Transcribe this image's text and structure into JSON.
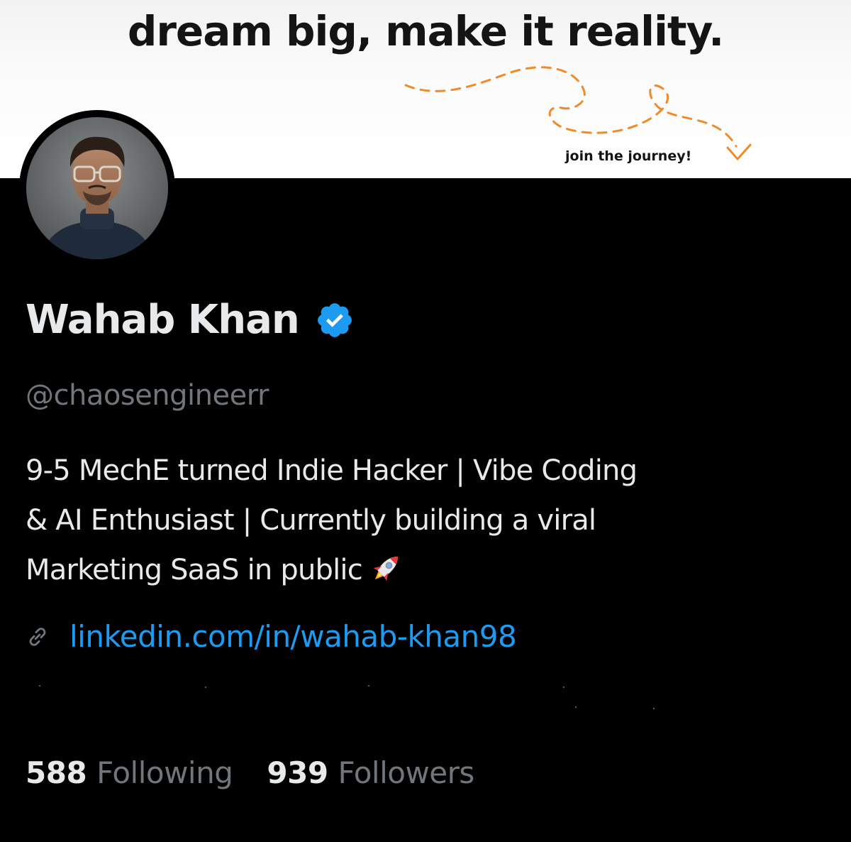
{
  "banner": {
    "headline": "dream big, make it reality.",
    "cta": "join the journey!",
    "accent_color": "#f08a2a"
  },
  "profile": {
    "avatar_icon": "profile-photo",
    "display_name": "Wahab Khan",
    "verified_icon": "verified-badge-icon",
    "verified_color": "#1d9bf0",
    "handle": "@chaosengineerr",
    "bio_lines": [
      "9-5 MechE turned Indie Hacker | Vibe Coding",
      "& AI Enthusiast | Currently building a viral",
      "Marketing SaaS in public"
    ],
    "bio_emoji": "rocket-emoji",
    "link_icon": "link-icon",
    "link_text": "linkedin.com/in/wahab-khan98",
    "link_color": "#1d9bf0"
  },
  "stats": {
    "following_count": "588",
    "following_label": "Following",
    "followers_count": "939",
    "followers_label": "Followers"
  }
}
